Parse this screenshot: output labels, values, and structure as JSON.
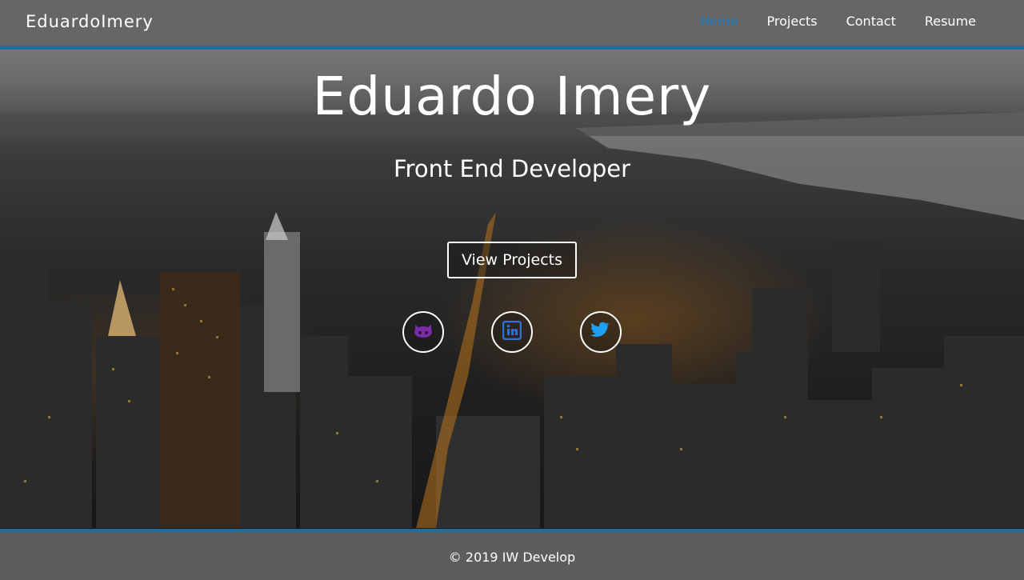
{
  "navbar": {
    "brand": "EduardoImery",
    "links": [
      {
        "label": "Home",
        "active": true
      },
      {
        "label": "Projects",
        "active": false
      },
      {
        "label": "Contact",
        "active": false
      },
      {
        "label": "Resume",
        "active": false
      }
    ]
  },
  "hero": {
    "title": "Eduardo Imery",
    "subtitle": "Front End Developer",
    "cta_label": "View Projects"
  },
  "social": [
    {
      "icon": "github-icon",
      "color": "#7a2ea6"
    },
    {
      "icon": "linkedin-icon",
      "color": "#2f6fd8"
    },
    {
      "icon": "twitter-icon",
      "color": "#1da1f2"
    }
  ],
  "footer": {
    "text": "© 2019 IW Develop"
  },
  "colors": {
    "accent": "#1f6e9e",
    "active_link": "#1f7bbd",
    "navbar_bg": "#646464"
  }
}
